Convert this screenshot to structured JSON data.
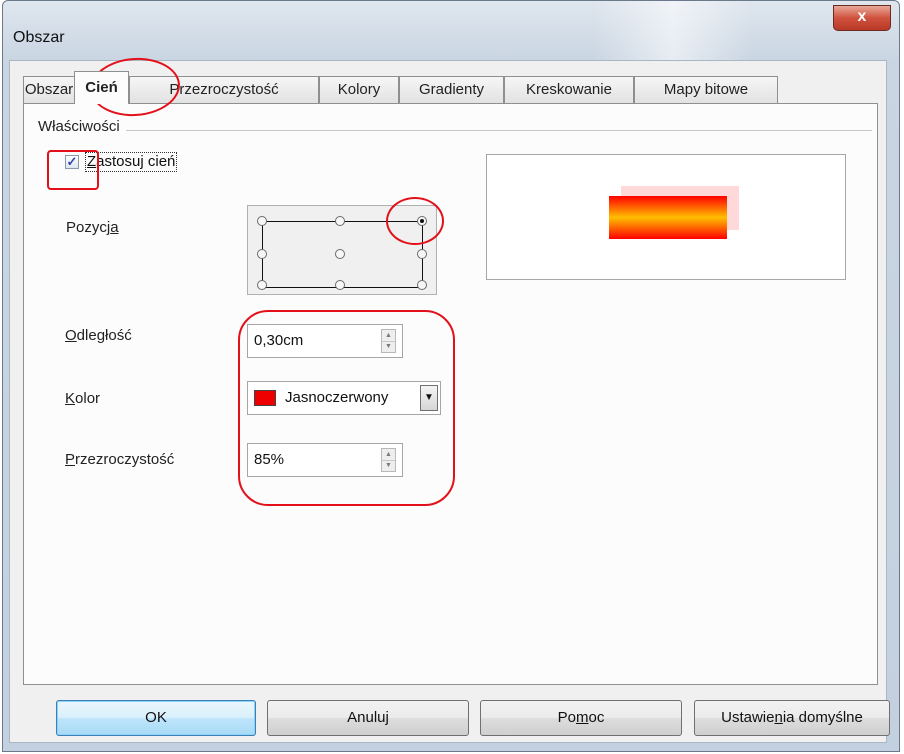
{
  "window": {
    "title": "Obszar",
    "close_label": "x"
  },
  "tabs": [
    {
      "label": "Obszar",
      "active": false
    },
    {
      "label": "Cień",
      "active": true
    },
    {
      "label": "Przezroczystość",
      "active": false
    },
    {
      "label": "Kolory",
      "active": false
    },
    {
      "label": "Gradienty",
      "active": false
    },
    {
      "label": "Kreskowanie",
      "active": false
    },
    {
      "label": "Mapy bitowe",
      "active": false
    }
  ],
  "properties": {
    "group_label": "Właściwości",
    "apply_shadow": {
      "pre": "",
      "accel": "Z",
      "post": "astosuj cień",
      "checked": true
    },
    "position": {
      "pre": "Pozycj",
      "accel": "a",
      "post": "",
      "selected": "top-right"
    },
    "distance": {
      "pre": "",
      "accel": "O",
      "post": "dległość",
      "value": "0,30cm"
    },
    "color": {
      "pre": "",
      "accel": "K",
      "post": "olor",
      "value": "Jasnoczerwony",
      "swatch": "#ee0000"
    },
    "transparency": {
      "pre": "",
      "accel": "P",
      "post": "rzezroczystość",
      "value": "85%"
    }
  },
  "buttons": {
    "ok": "OK",
    "cancel": "Anuluj",
    "help": {
      "pre": "Po",
      "accel": "m",
      "post": "oc"
    },
    "defaults": {
      "pre": "Ustawie",
      "accel": "n",
      "post": "ia domyślne"
    }
  },
  "colors": {
    "accent_annotation": "#e3101a",
    "preview_gradient": [
      "#ff0000",
      "#ffbf00"
    ],
    "shadow": "#ffd9d9"
  }
}
